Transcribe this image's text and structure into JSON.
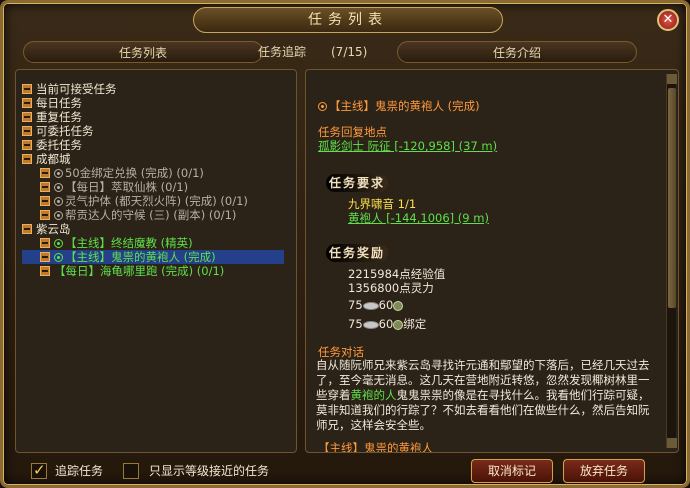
{
  "window": {
    "title": "任务列表"
  },
  "tabs": {
    "list": "任务列表",
    "track": "任务追踪",
    "count": "(7/15)",
    "intro": "任务介绍"
  },
  "tree": {
    "cat1": "当前可接受任务",
    "cat2": "每日任务",
    "cat3": "重复任务",
    "cat4": "可委托任务",
    "cat5": "委托任务",
    "cat6": "成都城",
    "q1": "50金绑定兑换 (完成) (0/1)",
    "q2": "【每日】萃取仙株 (0/1)",
    "q3": "灵气护体 (都天烈火阵) (完成) (0/1)",
    "q4": "帮贡达人的守候 (三) (副本) (0/1)",
    "cat7": "紫云岛",
    "q5": "【主线】终结魔教 (精英)",
    "q6": "【主线】鬼祟的黄袍人 (完成)",
    "q7": "【每日】海龟哪里跑 (完成) (0/1)"
  },
  "detail": {
    "quest_title": "【主线】鬼祟的黄袍人 (完成)",
    "return_label": "任务回复地点",
    "return_npc": "孤影剑士 阮征 [-120,958] (37 m)",
    "req_banner": "任务要求",
    "req_item": "九界啸音  1/1",
    "req_target": "黄袍人 [-144,1006] (9 m)",
    "reward_banner": "任务奖励",
    "exp": "2215984点经验值",
    "spirit": "1356800点灵力",
    "money1_a": "75",
    "money1_b": "60",
    "money2_a": "75",
    "money2_b": "60",
    "bound": "绑定",
    "dialog_label": "任务对话",
    "dialog_text_1": "自从随阮师兄来紫云岛寻找许元通和鄢望的下落后，已经几天过去了，至今毫无消息。这几天在营地附近转悠，忽然发现椰树林里一些穿着",
    "dialog_hl": "黄袍的人",
    "dialog_text_2": "鬼鬼祟祟的像是在寻找什么。我看他们行踪可疑，莫非知道我们的行踪了？不如去看看他们在做些什么，然后告知阮师兄，这样会安全些。",
    "cut_line": "【主线】鬼祟的黄袍人"
  },
  "bottom": {
    "track_label": "追踪任务",
    "track_checked": true,
    "near_label": "只显示等级接近的任务",
    "near_checked": false,
    "cancel_btn": "取消标记",
    "abandon_btn": "放弃任务"
  }
}
